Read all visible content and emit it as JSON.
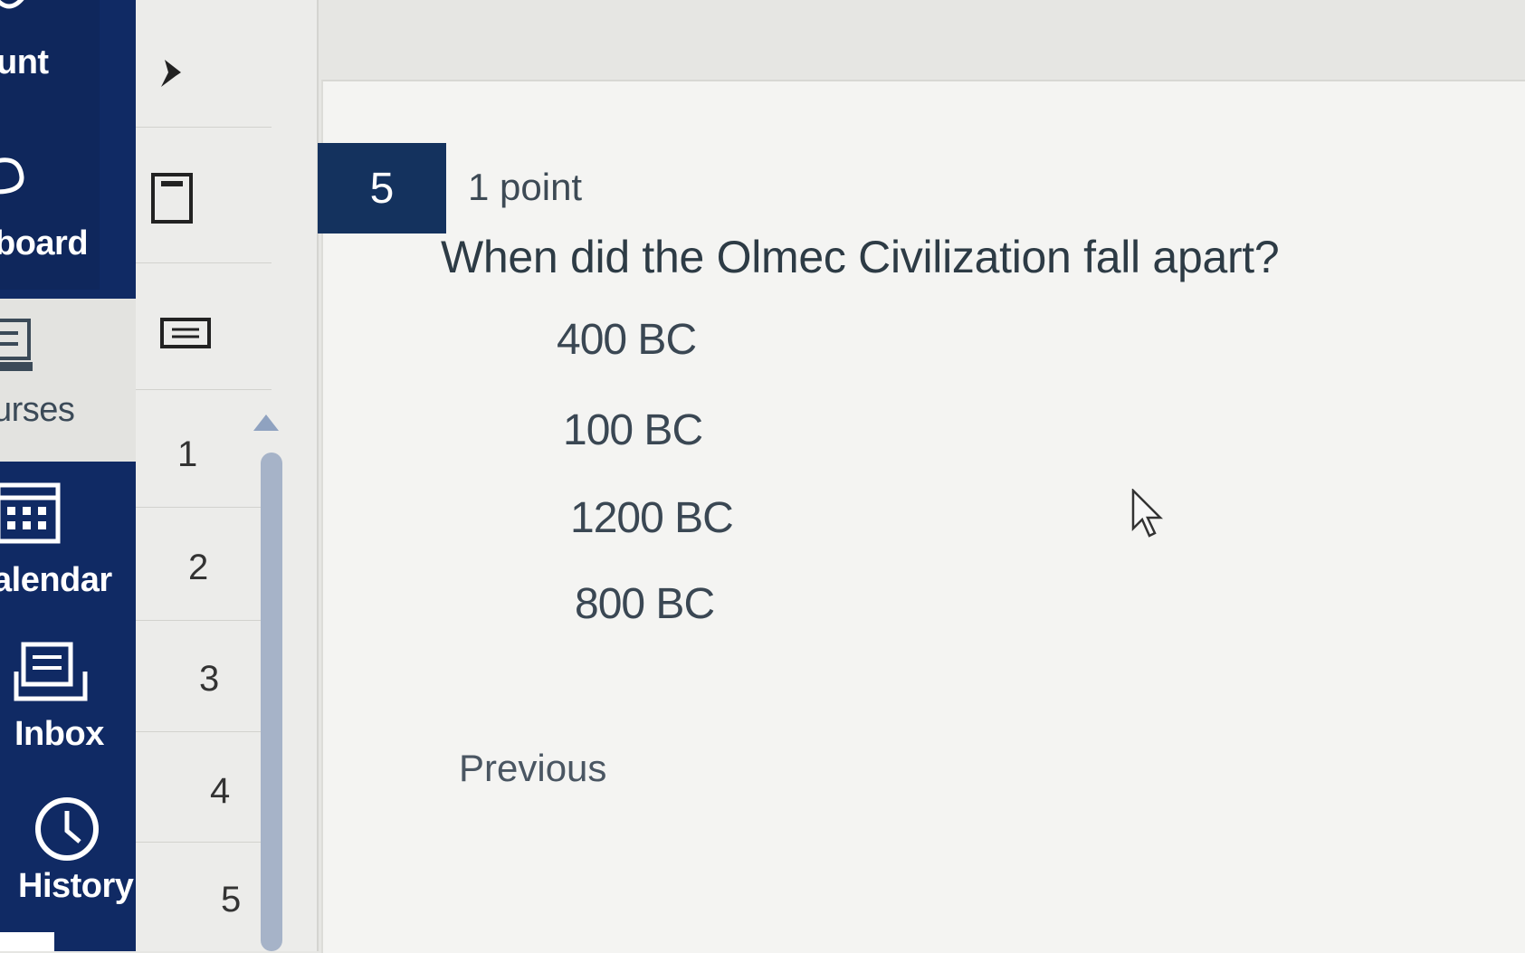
{
  "global_nav": {
    "items": [
      {
        "label": "unt",
        "icon": "account-icon"
      },
      {
        "label": "board",
        "icon": "dashboard-icon"
      },
      {
        "label": "urses",
        "icon": "courses-icon"
      },
      {
        "label": "alendar",
        "icon": "calendar-icon"
      },
      {
        "label": "Inbox",
        "icon": "inbox-icon"
      },
      {
        "label": "History",
        "icon": "history-icon"
      }
    ]
  },
  "quiz_nav": {
    "icons": [
      "pin-icon",
      "calculator-icon",
      "notes-icon"
    ],
    "question_numbers": [
      "1",
      "2",
      "3",
      "4",
      "5"
    ]
  },
  "question": {
    "number": "5",
    "points": "1 point",
    "text": "When did the Olmec Civilization fall apart?",
    "answers": [
      "400 BC",
      "100 BC",
      "1200 BC",
      "800 BC"
    ]
  },
  "navigation": {
    "previous_label": "Previous"
  },
  "colors": {
    "nav_bg": "#102a64",
    "badge_bg": "#14325e",
    "page_bg": "#e6e6e3"
  }
}
